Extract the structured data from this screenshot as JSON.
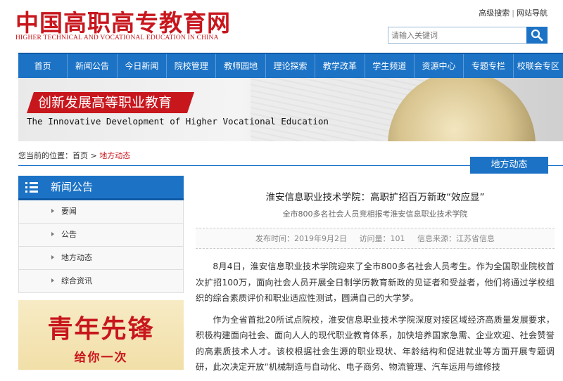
{
  "header": {
    "logo_title": "中国高职高专教育网",
    "logo_subtitle": "HIGHER TECHNICAL AND VOCATIONAL EDUCATION IN CHINA",
    "links": [
      "高级搜索",
      "网站导航"
    ],
    "search_placeholder": "请输入关键词",
    "search_icon": "search-icon"
  },
  "nav": {
    "items": [
      "首页",
      "新闻公告",
      "今日新闻",
      "院校管理",
      "教师园地",
      "理论探索",
      "教学改革",
      "学生频道",
      "资源中心",
      "专题专栏",
      "校联会专区"
    ]
  },
  "banner": {
    "caption": "创新发展高等职业教育",
    "english": "The Innovative Development of Higher Vocational Education"
  },
  "breadcrumb": {
    "prefix": "您当前的位置：",
    "home": "首页",
    "sep": ">",
    "current": "地方动态"
  },
  "section_tab": "地方动态",
  "sidebar": {
    "title": "新闻公告",
    "items": [
      "要闻",
      "公告",
      "地方动态",
      "综合资讯"
    ]
  },
  "promo": {
    "line1": "青年先锋",
    "line2": "给你一次"
  },
  "article": {
    "title": "淮安信息职业技术学院：高职扩招百万新政“效应显”",
    "subtitle": "全市800多名社会人员竞相报考淮安信息职业技术学院",
    "publish": "发布时间：2019年9月2日",
    "views": "访问量：101",
    "source": "信息来源：江苏省信息",
    "para1": "8月4日，淮安信息职业技术学院迎来了全市800多名社会人员考生。作为全国职业院校首次扩招100万，面向社会人员开展全日制学历教育新政的见证者和受益者，他们将通过学校组织的综合素质评价和职业适应性测试，圆满自己的大学梦。",
    "para2": "作为全省首批20所试点院校，淮安信息职业技术学院深度对接区域经济高质量发展要求，积极构建面向社会、面向人人的现代职业教育体系，加快培养国家急需、企业欢迎、社会赞誉的高素质技术人才。该校根据社会生源的职业现状、年龄结构和促进就业等方面开展专题调研，此次决定开放“机械制造与自动化、电子商务、物流管理、汽车运用与维修技"
  }
}
